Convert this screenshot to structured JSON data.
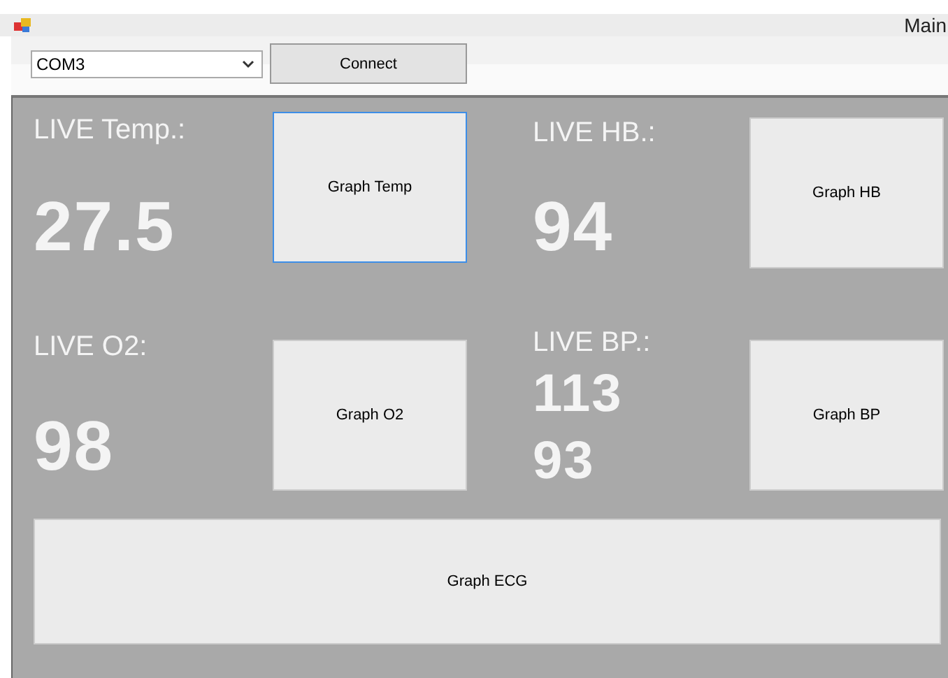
{
  "window": {
    "title": "Main"
  },
  "toolbar": {
    "port": {
      "value": "COM3"
    },
    "connect_button": "Connect"
  },
  "readings": [
    {
      "label": "LIVE Temp.:",
      "values": [
        "27.5"
      ],
      "button": {
        "label": "Graph Temp",
        "focused": true
      }
    },
    {
      "label": "LIVE HB.:",
      "values": [
        "94"
      ],
      "button": {
        "label": "Graph HB",
        "focused": false
      }
    },
    {
      "label": "LIVE O2:",
      "values": [
        "98"
      ],
      "button": {
        "label": "Graph O2",
        "focused": false
      }
    },
    {
      "label": "LIVE BP.:",
      "values": [
        "113",
        "93"
      ],
      "button": {
        "label": "Graph BP",
        "focused": false
      }
    }
  ],
  "ecg_button": {
    "label": "Graph ECG",
    "focused": false
  }
}
